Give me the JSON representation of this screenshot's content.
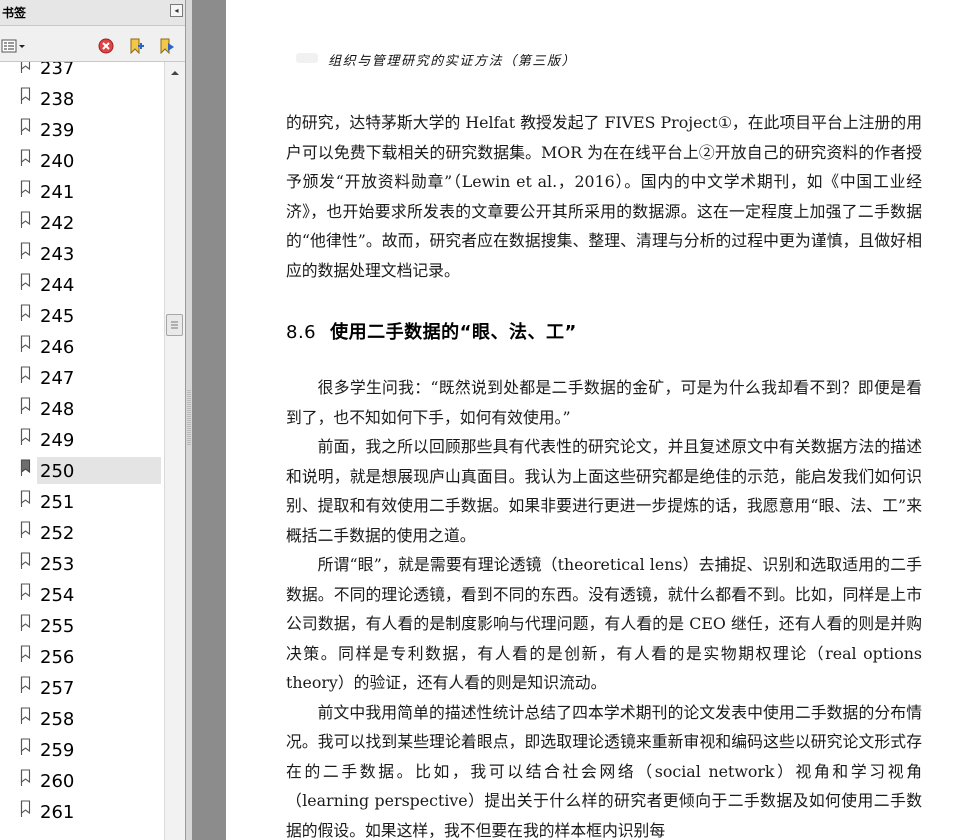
{
  "sidebar": {
    "title": "书签",
    "collapse_icon": "chevron-left-icon",
    "toolbar": {
      "options_icon": "bookmark-options-icon",
      "delete_icon": "delete-icon",
      "new_icon": "new-bookmark-icon",
      "expand_icon": "expand-bookmark-icon"
    },
    "selected": "250",
    "bookmarks": [
      "237",
      "238",
      "239",
      "240",
      "241",
      "242",
      "243",
      "244",
      "245",
      "246",
      "247",
      "248",
      "249",
      "250",
      "251",
      "252",
      "253",
      "254",
      "255",
      "256",
      "257",
      "258",
      "259",
      "260",
      "261"
    ]
  },
  "page": {
    "running_head": "组织与管理研究的实证方法（第三版）",
    "para1": "的研究，达特茅斯大学的 Helfat 教授发起了 FIVES Project①，在此项目平台上注册的用户可以免费下载相关的研究数据集。MOR 为在在线平台上②开放自己的研究资料的作者授予颁发“开放资料勋章”（Lewin et al.，2016）。国内的中文学术期刊，如《中国工业经济》，也开始要求所发表的文章要公开其所采用的数据源。这在一定程度上加强了二手数据的“他律性”。故而，研究者应在数据搜集、整理、清理与分析的过程中更为谨慎，且做好相应的数据处理文档记录。",
    "section_number": "8.6",
    "section_title": "使用二手数据的“眼、法、工”",
    "para2": "很多学生问我：“既然说到处都是二手数据的金矿，可是为什么我却看不到？即便是看到了，也不知如何下手，如何有效使用。”",
    "para3": "前面，我之所以回顾那些具有代表性的研究论文，并且复述原文中有关数据方法的描述和说明，就是想展现庐山真面目。我认为上面这些研究都是绝佳的示范，能启发我们如何识别、提取和有效使用二手数据。如果非要进行更进一步提炼的话，我愿意用“眼、法、工”来概括二手数据的使用之道。",
    "para4": "所谓“眼”，就是需要有理论透镜（theoretical lens）去捕捉、识别和选取适用的二手数据。不同的理论透镜，看到不同的东西。没有透镜，就什么都看不到。比如，同样是上市公司数据，有人看的是制度影响与代理问题，有人看的是 CEO 继任，还有人看的则是并购决策。同样是专利数据，有人看的是创新，有人看的是实物期权理论（real options theory）的验证，还有人看的则是知识流动。",
    "para5": "前文中我用简单的描述性统计总结了四本学术期刊的论文发表中使用二手数据的分布情况。我可以找到某些理论着眼点，即选取理论透镜来重新审视和编码这些以研究论文形式存在的二手数据。比如，我可以结合社会网络（social network）视角和学习视角（learning perspective）提出关于什么样的研究者更倾向于二手数据及如何使用二手数据的假设。如果这样，我不但要在我的样本框内识别每"
  }
}
